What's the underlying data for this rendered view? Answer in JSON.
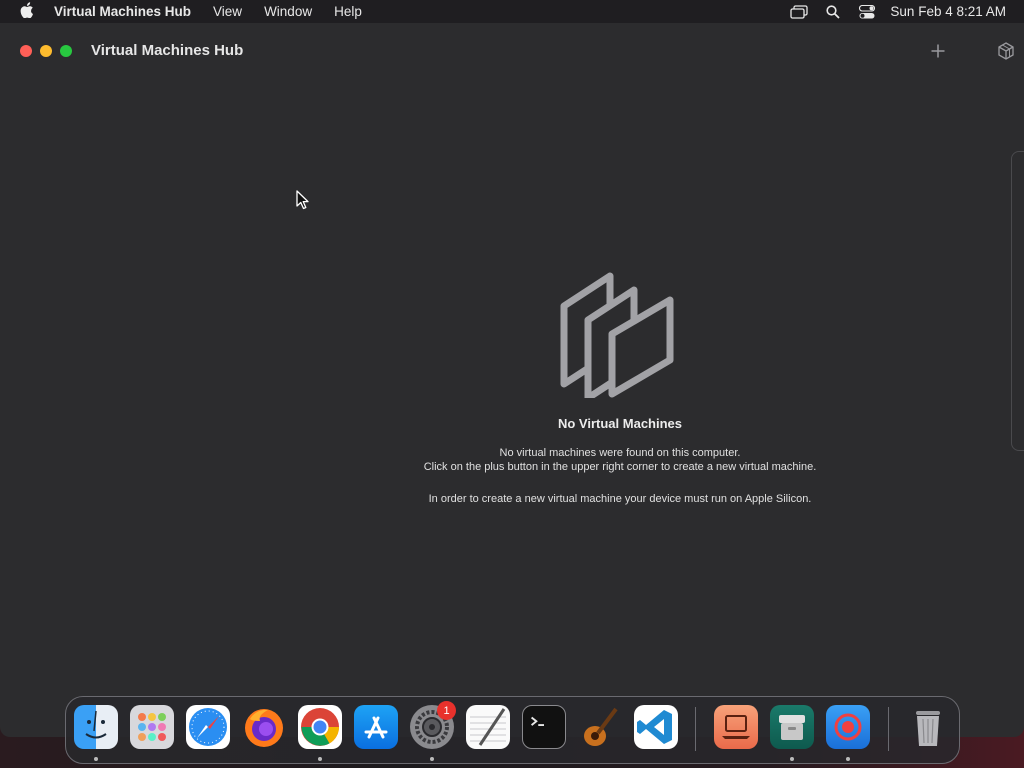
{
  "menubar": {
    "app_name": "Virtual Machines Hub",
    "items": [
      "View",
      "Window",
      "Help"
    ],
    "clock": "Sun Feb 4  8:21 AM"
  },
  "window": {
    "title": "Virtual Machines Hub"
  },
  "empty_state": {
    "title": "No Virtual Machines",
    "line1": "No virtual machines were found on this computer.",
    "line2": "Click on the plus button in the upper right corner to create a new virtual machine.",
    "line3": "In order to create a new virtual machine your device must run on Apple Silicon."
  },
  "dock": {
    "apps": [
      "Finder",
      "Launchpad",
      "Safari",
      "Firefox",
      "Chrome",
      "App Store",
      "System Settings",
      "TextEdit",
      "Terminal",
      "GarageBand",
      "Visual Studio Code",
      "Virtual Machines Hub",
      "Archive",
      "Screen Recorder",
      "Trash"
    ],
    "settings_badge": "1"
  },
  "colors": {
    "window_bg": "#2c2c2e",
    "close": "#ff5f57",
    "minimize": "#febc2e",
    "maximize": "#28c840",
    "badge": "#e8312c"
  }
}
